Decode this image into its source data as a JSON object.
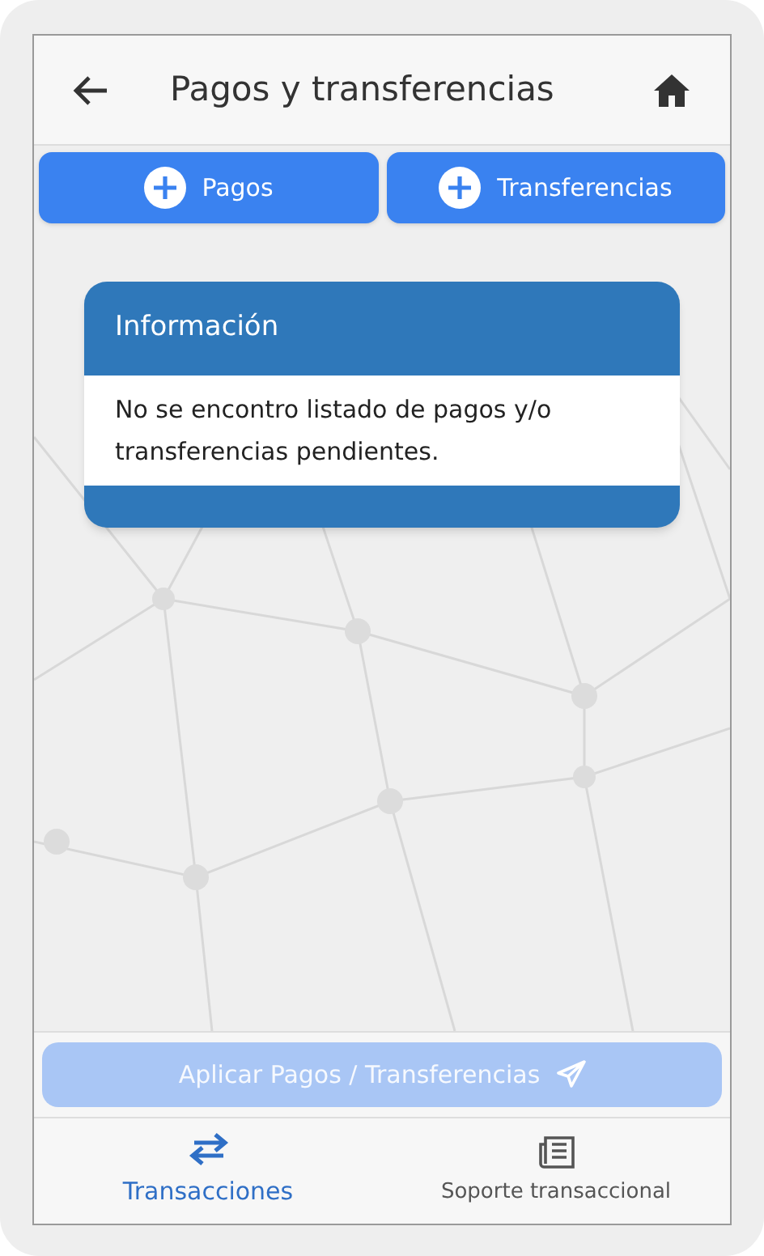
{
  "header": {
    "title": "Pagos y transferencias"
  },
  "actions": [
    {
      "label": "Pagos"
    },
    {
      "label": "Transferencias"
    }
  ],
  "info_card": {
    "title": "Información",
    "message": "No se encontro listado de pagos y/o transferencias pendientes."
  },
  "apply_button": {
    "label": "Aplicar Pagos / Transferencias",
    "disabled": true
  },
  "bottom_nav": [
    {
      "label": "Transacciones",
      "kind": "transactions",
      "selected": true
    },
    {
      "label": "Soporte transaccional",
      "kind": "support",
      "selected": false
    }
  ]
}
